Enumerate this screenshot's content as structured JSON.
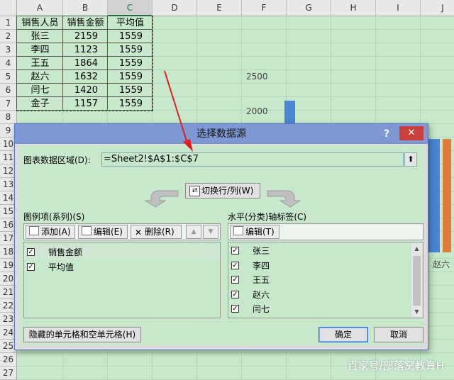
{
  "sheet": {
    "columns": [
      "A",
      "B",
      "C",
      "D",
      "E",
      "F",
      "G",
      "H",
      "I",
      "J"
    ],
    "rows": [
      "1",
      "2",
      "3",
      "4",
      "5",
      "6",
      "7",
      "8",
      "9",
      "10",
      "11",
      "12",
      "13",
      "14",
      "15",
      "16",
      "17",
      "18",
      "19",
      "20",
      "21",
      "22",
      "23",
      "24",
      "25",
      "26",
      "27"
    ],
    "headers": [
      "销售人员",
      "销售金额",
      "平均值"
    ],
    "data": [
      [
        "张三",
        "2159",
        "1559"
      ],
      [
        "李四",
        "1123",
        "1559"
      ],
      [
        "王五",
        "1864",
        "1559"
      ],
      [
        "赵六",
        "1632",
        "1559"
      ],
      [
        "闫七",
        "1420",
        "1559"
      ],
      [
        "金子",
        "1157",
        "1559"
      ]
    ]
  },
  "chart_data": {
    "type": "bar",
    "y_ticks": [
      "2500",
      "2000"
    ],
    "visible_category": "赵六",
    "colors": {
      "sales": "#4a86d4",
      "avg": "#e07b39"
    }
  },
  "dialog": {
    "title": "选择数据源",
    "help": "?",
    "close": "✕",
    "range_label": "图表数据区域(D):",
    "range_value": "=Sheet2!$A$1:$C$7",
    "range_button": "⬆",
    "switch_label": "切换行/列(W)",
    "series_label": "图例项(系列)(S)",
    "series_toolbar": {
      "add": "添加(A)",
      "edit": "编辑(E)",
      "delete": "删除(R)",
      "up": "▲",
      "down": "▼"
    },
    "series": [
      "销售金额",
      "平均值"
    ],
    "axis_label": "水平(分类)轴标签(C)",
    "axis_edit": "编辑(T)",
    "axis_items": [
      "张三",
      "李四",
      "王五",
      "赵六",
      "闫七"
    ],
    "hidden_button": "隐藏的单元格和空单元格(H)",
    "ok": "确定",
    "cancel": "取消"
  },
  "watermark": "百家号/部落窝教育H"
}
